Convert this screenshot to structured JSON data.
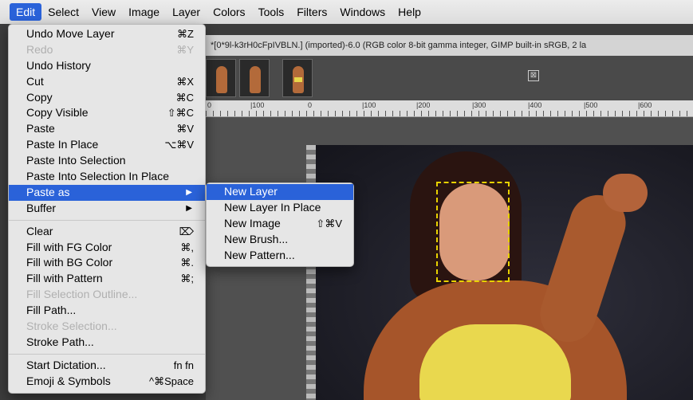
{
  "menubar": {
    "items": [
      "Edit",
      "Select",
      "View",
      "Image",
      "Layer",
      "Colors",
      "Tools",
      "Filters",
      "Windows",
      "Help"
    ]
  },
  "window": {
    "title": "*[0*9l-k3rH0cFpIVBLN.] (imported)-6.0 (RGB color 8-bit gamma integer, GIMP built-in sRGB, 2 la"
  },
  "ruler": {
    "labels": [
      "0",
      "|100",
      "0",
      "|100",
      "|200",
      "|300",
      "|400",
      "|500",
      "|600"
    ]
  },
  "edit_menu": {
    "items": [
      {
        "label": "Undo Move Layer",
        "shortcut": "⌘Z",
        "disabled": false
      },
      {
        "label": "Redo",
        "shortcut": "⌘Y",
        "disabled": true
      },
      {
        "label": "Undo History",
        "shortcut": "",
        "disabled": false
      },
      {
        "label": "Cut",
        "shortcut": "⌘X",
        "disabled": false
      },
      {
        "label": "Copy",
        "shortcut": "⌘C",
        "disabled": false
      },
      {
        "label": "Copy Visible",
        "shortcut": "⇧⌘C",
        "disabled": false
      },
      {
        "label": "Paste",
        "shortcut": "⌘V",
        "disabled": false
      },
      {
        "label": "Paste In Place",
        "shortcut": "⌥⌘V",
        "disabled": false
      },
      {
        "label": "Paste Into Selection",
        "shortcut": "",
        "disabled": false
      },
      {
        "label": "Paste Into Selection In Place",
        "shortcut": "",
        "disabled": false
      },
      {
        "label": "Paste as",
        "shortcut": "▶",
        "disabled": false
      },
      {
        "label": "Buffer",
        "shortcut": "▶",
        "disabled": false
      },
      {
        "label": "Clear",
        "shortcut": "⌦",
        "disabled": false
      },
      {
        "label": "Fill with FG Color",
        "shortcut": "⌘,",
        "disabled": false
      },
      {
        "label": "Fill with BG Color",
        "shortcut": "⌘.",
        "disabled": false
      },
      {
        "label": "Fill with Pattern",
        "shortcut": "⌘;",
        "disabled": false
      },
      {
        "label": "Fill Selection Outline...",
        "shortcut": "",
        "disabled": true
      },
      {
        "label": "Fill Path...",
        "shortcut": "",
        "disabled": false
      },
      {
        "label": "Stroke Selection...",
        "shortcut": "",
        "disabled": true
      },
      {
        "label": "Stroke Path...",
        "shortcut": "",
        "disabled": false
      },
      {
        "label": "Start Dictation...",
        "shortcut": "fn fn",
        "disabled": false
      },
      {
        "label": "Emoji & Symbols",
        "shortcut": "^⌘Space",
        "disabled": false
      }
    ]
  },
  "paste_submenu": {
    "items": [
      {
        "label": "New Layer",
        "shortcut": ""
      },
      {
        "label": "New Layer In Place",
        "shortcut": ""
      },
      {
        "label": "New Image",
        "shortcut": "⇧⌘V"
      },
      {
        "label": "New Brush...",
        "shortcut": ""
      },
      {
        "label": "New Pattern...",
        "shortcut": ""
      }
    ]
  },
  "icons": {
    "tab_close": "⊠"
  },
  "colors": {
    "highlight": "#2a62d9",
    "selection_marquee": "#e8d200"
  }
}
